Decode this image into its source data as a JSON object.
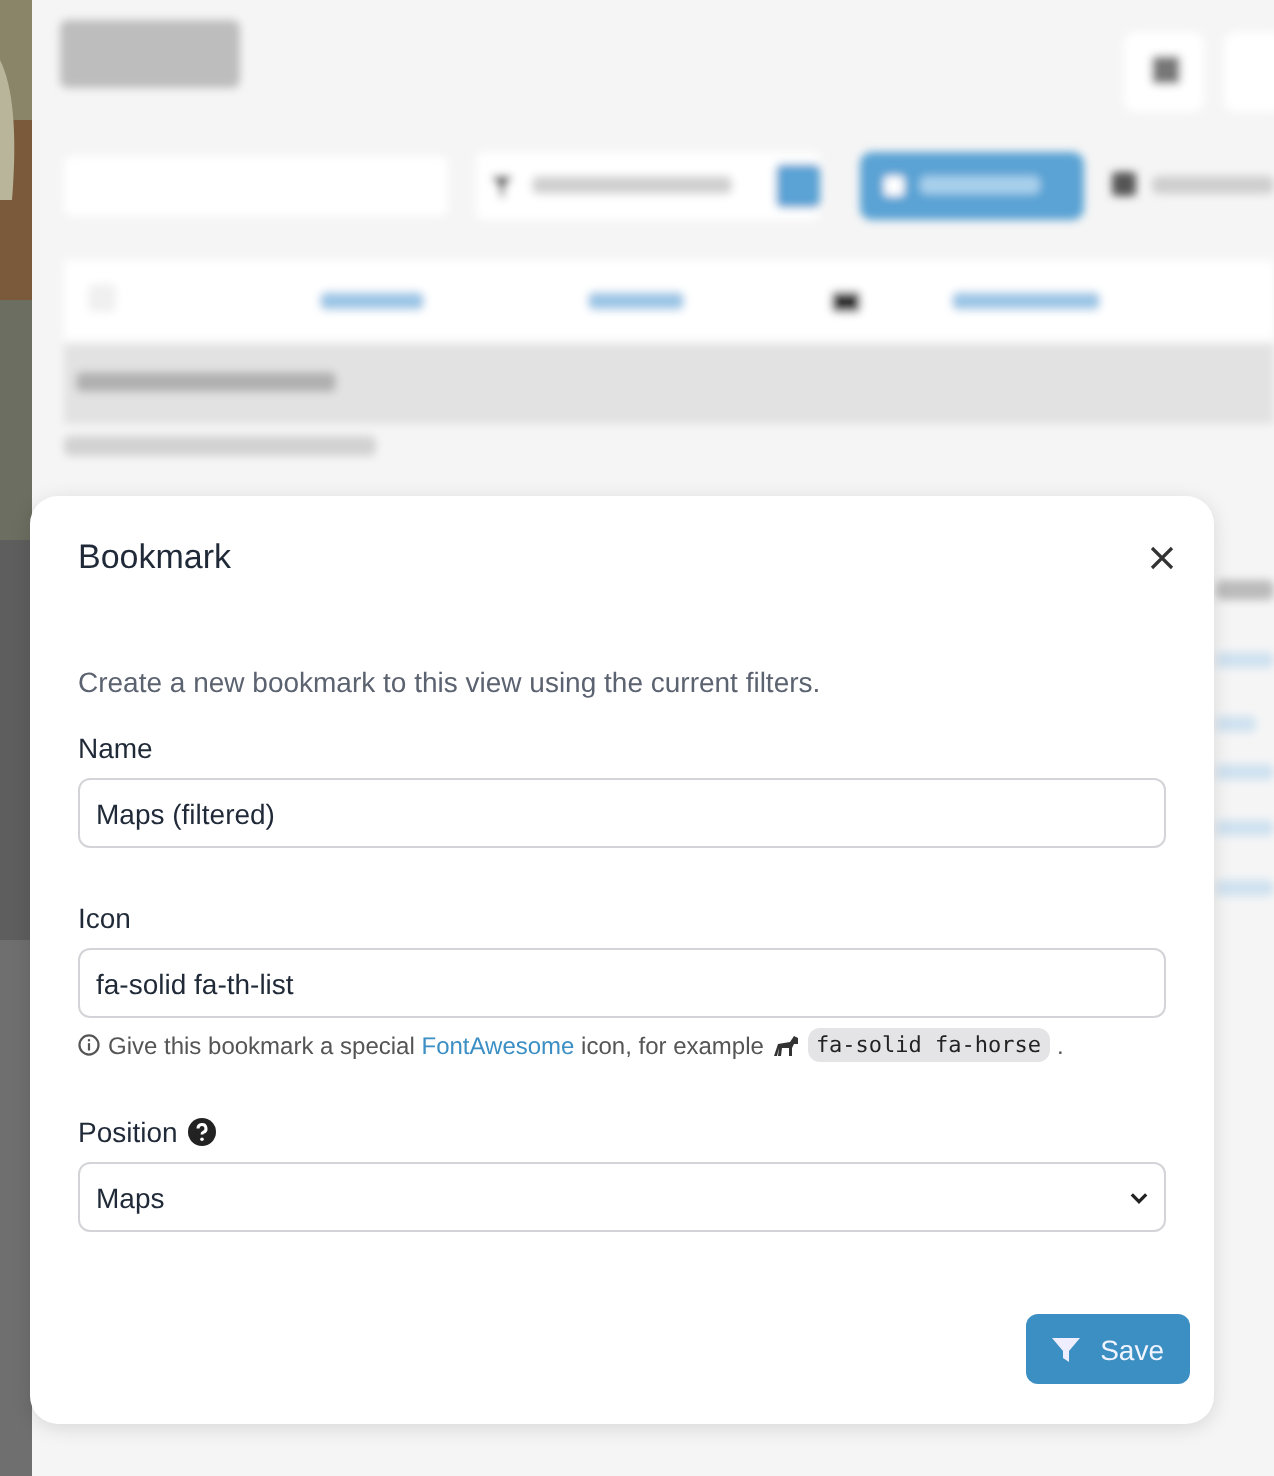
{
  "dialog": {
    "title": "Bookmark",
    "description": "Create a new bookmark to this view using the current filters.",
    "fields": [
      {
        "kind": "text",
        "label": "Name",
        "value": "Maps (filtered)"
      },
      {
        "kind": "text",
        "label": "Icon",
        "value": "fa-solid fa-th-list",
        "help": {
          "before": "Give this bookmark a special",
          "link": "FontAwesome",
          "after": "icon, for example",
          "code": "fa-solid fa-horse",
          "end": "."
        }
      },
      {
        "kind": "select",
        "label": "Position",
        "value": "Maps",
        "hint": true
      }
    ],
    "button": "Save"
  }
}
